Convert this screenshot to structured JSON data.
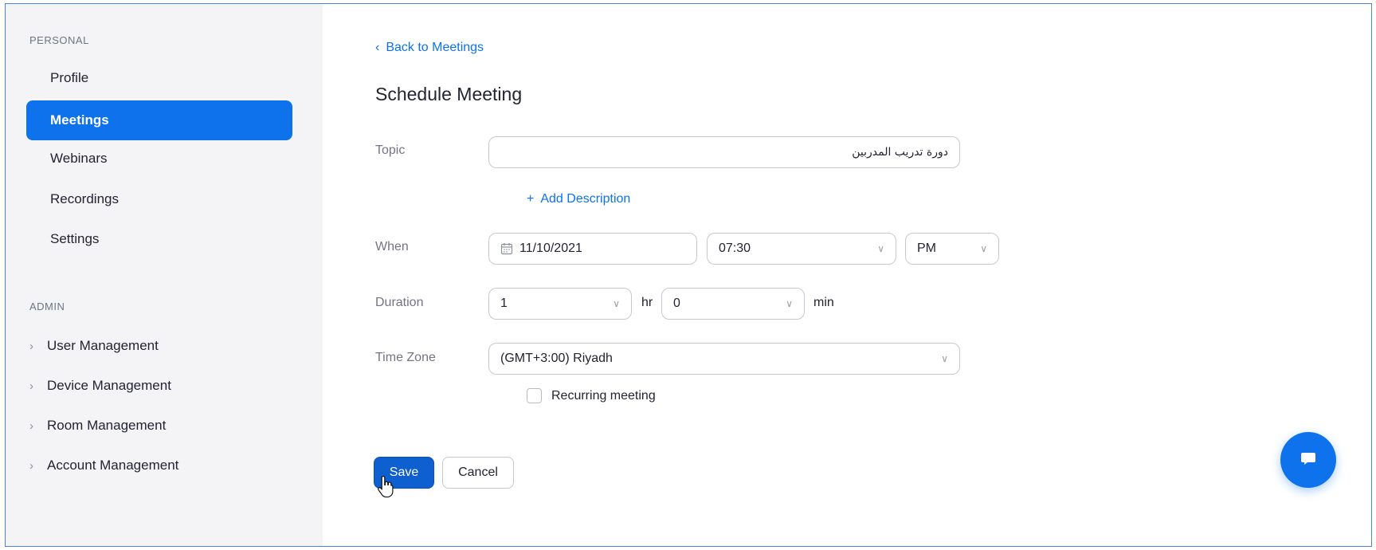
{
  "sidebar": {
    "personal_label": "PERSONAL",
    "items": [
      {
        "label": "Profile",
        "active": false
      },
      {
        "label": "Meetings",
        "active": true
      },
      {
        "label": "Webinars",
        "active": false
      },
      {
        "label": "Recordings",
        "active": false
      },
      {
        "label": "Settings",
        "active": false
      }
    ],
    "admin_label": "ADMIN",
    "admin_items": [
      {
        "label": "User Management",
        "icon": "chevron-right-icon"
      },
      {
        "label": "Device Management",
        "icon": "chevron-right-icon"
      },
      {
        "label": "Room Management",
        "icon": "chevron-right-icon"
      },
      {
        "label": "Account Management",
        "icon": "chevron-right-icon"
      }
    ]
  },
  "main": {
    "back_link": "Back to Meetings",
    "title": "Schedule Meeting",
    "topic": {
      "label": "Topic",
      "value": "دورة تدريب المدربين"
    },
    "add_description": "Add Description",
    "when": {
      "label": "When",
      "date": "11/10/2021",
      "time": "07:30",
      "ampm": "PM"
    },
    "duration": {
      "label": "Duration",
      "hours": "1",
      "hours_unit": "hr",
      "minutes": "0",
      "minutes_unit": "min"
    },
    "time_zone": {
      "label": "Time Zone",
      "value": "(GMT+3:00) Riyadh"
    },
    "recurring": {
      "label": "Recurring meeting",
      "checked": false
    },
    "buttons": {
      "save": "Save",
      "cancel": "Cancel"
    }
  },
  "colors": {
    "accent": "#0e72ed",
    "sidebar_bg": "#f4f4f6",
    "save_button": "#0e5fd0"
  }
}
